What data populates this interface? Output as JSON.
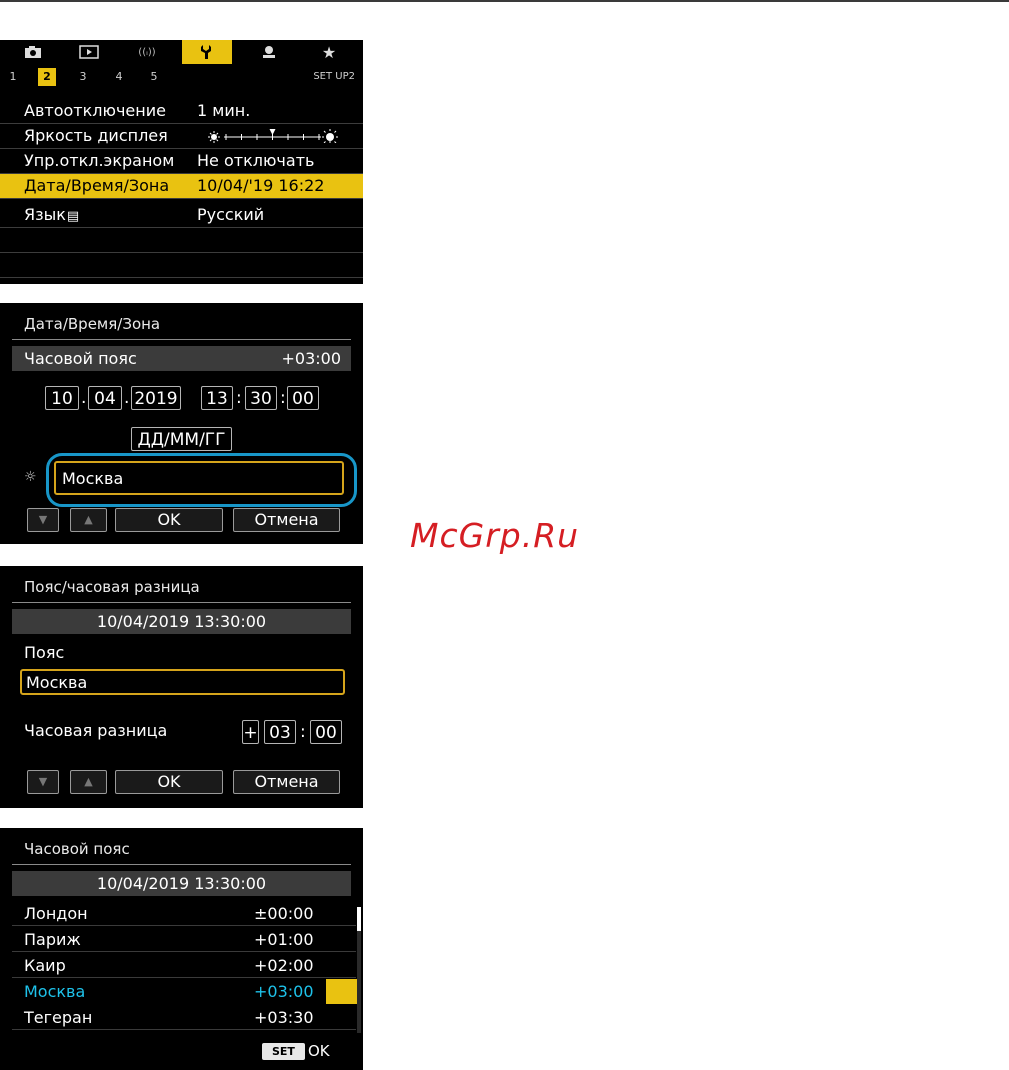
{
  "menu": {
    "page_numbers": [
      "1",
      "2",
      "3",
      "4",
      "5"
    ],
    "active_page": "2",
    "setup_label": "SET UP2",
    "tabs": [
      {
        "icon": "camera-icon"
      },
      {
        "icon": "playback-icon"
      },
      {
        "icon": "wireless-icon"
      },
      {
        "icon": "wrench-icon",
        "active": true
      },
      {
        "icon": "custom-functions-icon"
      },
      {
        "icon": "my-menu-star-icon"
      }
    ],
    "rows": [
      {
        "label": "Автоотключение",
        "value": "1 мин."
      },
      {
        "label": "Яркость дисплея",
        "value": "",
        "brightness_level": 4,
        "brightness_steps": 7
      },
      {
        "label": "Упр.откл.экраном",
        "value": "Не отключать"
      },
      {
        "label": "Дата/Время/Зона",
        "value": "10/04/'19 16:22",
        "selected": true
      },
      {
        "label": "Язык",
        "value": "Русский"
      }
    ]
  },
  "datetime": {
    "title": "Дата/Время/Зона",
    "zone_label": "Часовой пояс",
    "zone_offset": "+03:00",
    "day": "10",
    "month": "04",
    "year": "2019",
    "hour": "13",
    "minute": "30",
    "second": "00",
    "date_format": "ДД/ММ/ГГ",
    "zone_name": "Москва",
    "ok": "OK",
    "cancel": "Отмена"
  },
  "zone_diff": {
    "title": "Пояс/часовая разница",
    "datetime": "10/04/2019 13:30:00",
    "zone_label": "Пояс",
    "zone_value": "Москва",
    "diff_label": "Часовая разница",
    "diff_sign": "+",
    "diff_hours": "03",
    "diff_minutes": "00",
    "ok": "OK",
    "cancel": "Отмена"
  },
  "zone_list": {
    "title": "Часовой пояс",
    "datetime": "10/04/2019 13:30:00",
    "items": [
      {
        "city": "Лондон",
        "offset": "±00:00"
      },
      {
        "city": "Париж",
        "offset": "+01:00"
      },
      {
        "city": "Каир",
        "offset": "+02:00"
      },
      {
        "city": "Москва",
        "offset": "+03:00",
        "selected": true
      },
      {
        "city": "Тегеран",
        "offset": "+03:30"
      }
    ],
    "set_label": "SET",
    "ok_label": "OK"
  },
  "watermark": "McGrp.Ru",
  "colors": {
    "highlight": "#e9c211",
    "selected_text": "#1ec2ea",
    "focus_ring": "#1896c8",
    "watermark": "#d51e23"
  }
}
